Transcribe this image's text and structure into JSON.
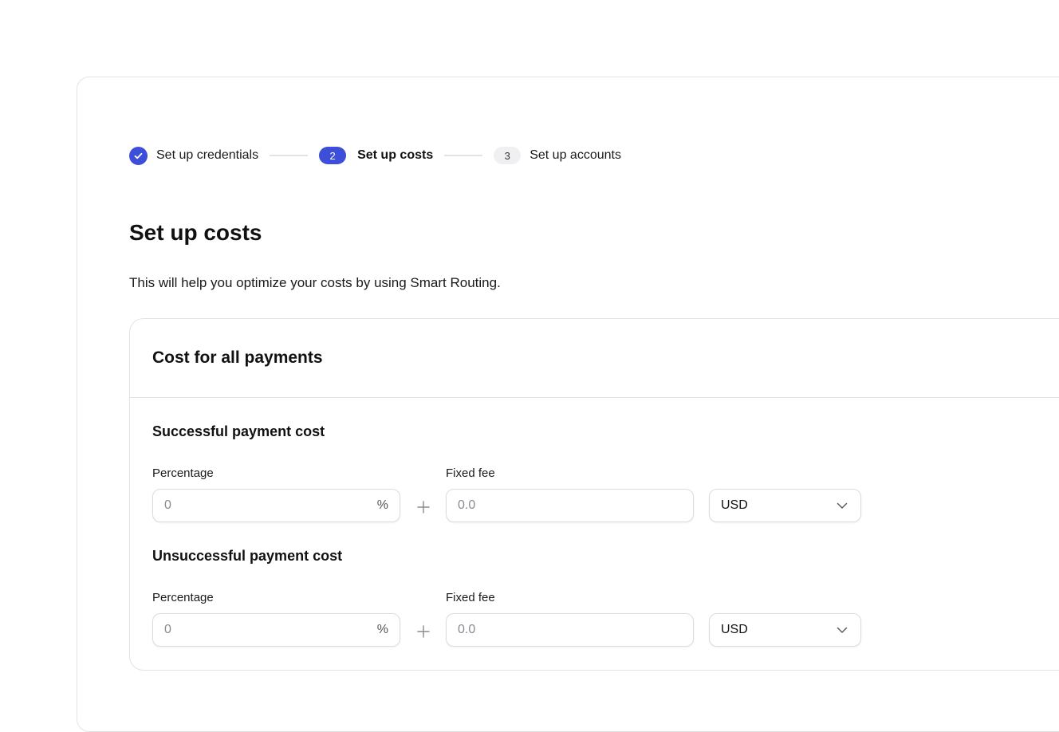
{
  "stepper": {
    "steps": [
      {
        "label": "Set up credentials",
        "state": "completed"
      },
      {
        "number": "2",
        "label": "Set up costs",
        "state": "active"
      },
      {
        "number": "3",
        "label": "Set up accounts",
        "state": "pending"
      }
    ]
  },
  "page": {
    "title": "Set up costs",
    "subtitle": "This will help you optimize your costs by using Smart Routing."
  },
  "card": {
    "title": "Cost for all payments",
    "successful": {
      "title": "Successful payment cost",
      "percentage_label": "Percentage",
      "percentage_placeholder": "0",
      "percentage_value": "",
      "percentage_suffix": "%",
      "fixed_fee_label": "Fixed fee",
      "fixed_fee_placeholder": "0.0",
      "fixed_fee_value": "",
      "currency": "USD"
    },
    "unsuccessful": {
      "title": "Unsuccessful payment cost",
      "percentage_label": "Percentage",
      "percentage_placeholder": "0",
      "percentage_value": "",
      "percentage_suffix": "%",
      "fixed_fee_label": "Fixed fee",
      "fixed_fee_placeholder": "0.0",
      "fixed_fee_value": "",
      "currency": "USD"
    }
  },
  "colors": {
    "accent": "#3d4fd8",
    "border": "#e3e3e6",
    "pending_badge": "#f0f0f2"
  },
  "icons": {
    "completed_step": "check-icon",
    "join": "plus-icon",
    "select": "chevron-down-icon"
  }
}
